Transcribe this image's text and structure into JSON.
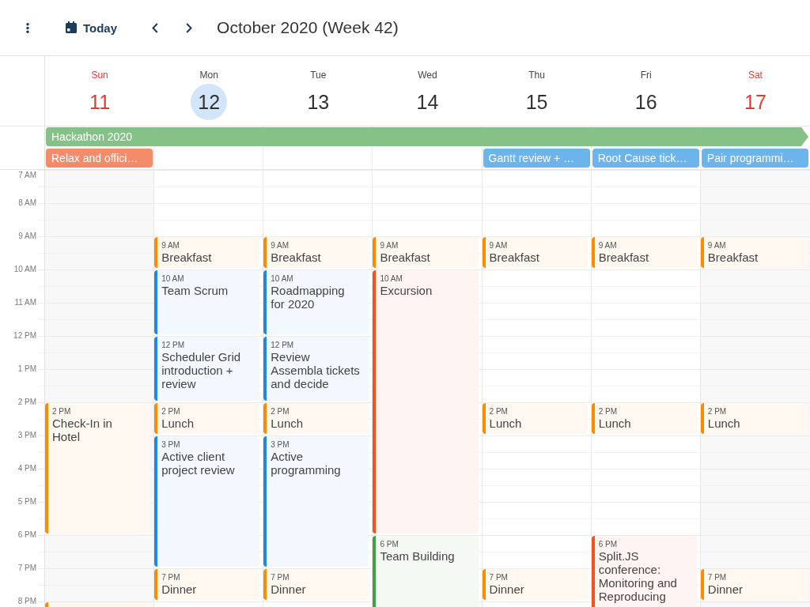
{
  "toolbar": {
    "today_button": "Today",
    "title": "October 2020 (Week 42)"
  },
  "days": [
    {
      "name": "Sun",
      "number": "11",
      "weekend": true,
      "today": false,
      "slots": [
        {
          "kind": "free"
        },
        {
          "kind": "free"
        },
        {
          "kind": "free"
        },
        {
          "kind": "free"
        },
        {
          "kind": "free"
        },
        {
          "kind": "free"
        },
        {
          "kind": "free"
        },
        {
          "kind": "event",
          "event": {
            "time": "2 PM",
            "title": "Check-In in Hotel",
            "color": "#fb8c00"
          }
        },
        {
          "kind": "continued"
        },
        {
          "kind": "continued"
        },
        {
          "kind": "continued"
        },
        {
          "kind": "free"
        },
        {
          "kind": "free"
        },
        {
          "kind": "event",
          "event": {
            "color": "#fb8c00"
          }
        }
      ]
    },
    {
      "name": "Mon",
      "number": "12",
      "weekend": false,
      "today": true,
      "slots": [
        {
          "kind": "free"
        },
        {
          "kind": "free"
        },
        {
          "kind": "event",
          "event": {
            "time": "9 AM",
            "title": "Breakfast",
            "color": "#fb8c00"
          }
        },
        {
          "kind": "event",
          "event": {
            "time": "10 AM",
            "title": "Team Scrum",
            "color": "#1e88e5"
          }
        },
        {
          "kind": "continued"
        },
        {
          "kind": "event",
          "event": {
            "time": "12 PM",
            "title": "Scheduler Grid introduction + review",
            "color": "#1e88e5"
          }
        },
        {
          "kind": "continued"
        },
        {
          "kind": "event",
          "event": {
            "time": "2 PM",
            "title": "Lunch",
            "color": "#fb8c00"
          }
        },
        {
          "kind": "event",
          "event": {
            "time": "3 PM",
            "title": "Active client project review",
            "color": "#1e88e5"
          }
        },
        {
          "kind": "continued"
        },
        {
          "kind": "continued"
        },
        {
          "kind": "continued"
        },
        {
          "kind": "event",
          "event": {
            "time": "7 PM",
            "title": "Dinner",
            "color": "#fb8c00"
          }
        },
        {
          "kind": "free"
        }
      ]
    },
    {
      "name": "Tue",
      "number": "13",
      "weekend": false,
      "today": false,
      "slots": [
        {
          "kind": "free"
        },
        {
          "kind": "free"
        },
        {
          "kind": "event",
          "event": {
            "time": "9 AM",
            "title": "Breakfast",
            "color": "#fb8c00"
          }
        },
        {
          "kind": "event",
          "event": {
            "time": "10 AM",
            "title": "Roadmapping for 2020",
            "color": "#1e88e5"
          }
        },
        {
          "kind": "continued"
        },
        {
          "kind": "event",
          "event": {
            "time": "12 PM",
            "title": "Review Assembla tickets and decide",
            "color": "#1e88e5"
          }
        },
        {
          "kind": "continued"
        },
        {
          "kind": "event",
          "event": {
            "time": "2 PM",
            "title": "Lunch",
            "color": "#fb8c00"
          }
        },
        {
          "kind": "event",
          "event": {
            "time": "3 PM",
            "title": "Active programming",
            "color": "#1e88e5"
          }
        },
        {
          "kind": "continued"
        },
        {
          "kind": "continued"
        },
        {
          "kind": "continued"
        },
        {
          "kind": "event",
          "event": {
            "time": "7 PM",
            "title": "Dinner",
            "color": "#fb8c00"
          }
        },
        {
          "kind": "free"
        }
      ]
    },
    {
      "name": "Wed",
      "number": "14",
      "weekend": false,
      "today": false,
      "slots": [
        {
          "kind": "free"
        },
        {
          "kind": "free"
        },
        {
          "kind": "event",
          "event": {
            "time": "9 AM",
            "title": "Breakfast",
            "color": "#fb8c00"
          }
        },
        {
          "kind": "event",
          "event": {
            "time": "10 AM",
            "title": "Excursion",
            "color": "#f4511e"
          }
        },
        {
          "kind": "continued"
        },
        {
          "kind": "continued"
        },
        {
          "kind": "continued"
        },
        {
          "kind": "continued"
        },
        {
          "kind": "continued"
        },
        {
          "kind": "continued"
        },
        {
          "kind": "continued"
        },
        {
          "kind": "event",
          "event": {
            "time": "6 PM",
            "title": "Team Building",
            "color": "#43a047"
          }
        },
        {
          "kind": "continued"
        },
        {
          "kind": "continued"
        }
      ]
    },
    {
      "name": "Thu",
      "number": "15",
      "weekend": false,
      "today": false,
      "slots": [
        {
          "kind": "free"
        },
        {
          "kind": "free"
        },
        {
          "kind": "event",
          "event": {
            "time": "9 AM",
            "title": "Breakfast",
            "color": "#fb8c00"
          }
        },
        {
          "kind": "free"
        },
        {
          "kind": "free"
        },
        {
          "kind": "free"
        },
        {
          "kind": "free"
        },
        {
          "kind": "event",
          "event": {
            "time": "2 PM",
            "title": "Lunch",
            "color": "#fb8c00"
          }
        },
        {
          "kind": "free"
        },
        {
          "kind": "free"
        },
        {
          "kind": "free"
        },
        {
          "kind": "free"
        },
        {
          "kind": "event",
          "event": {
            "time": "7 PM",
            "title": "Dinner",
            "color": "#fb8c00"
          }
        },
        {
          "kind": "free"
        }
      ]
    },
    {
      "name": "Fri",
      "number": "16",
      "weekend": false,
      "today": false,
      "slots": [
        {
          "kind": "free"
        },
        {
          "kind": "free"
        },
        {
          "kind": "event",
          "event": {
            "time": "9 AM",
            "title": "Breakfast",
            "color": "#fb8c00"
          }
        },
        {
          "kind": "free"
        },
        {
          "kind": "free"
        },
        {
          "kind": "free"
        },
        {
          "kind": "free"
        },
        {
          "kind": "event",
          "event": {
            "time": "2 PM",
            "title": "Lunch",
            "color": "#fb8c00"
          }
        },
        {
          "kind": "free"
        },
        {
          "kind": "free"
        },
        {
          "kind": "free"
        },
        {
          "kind": "event",
          "event": {
            "time": "6 PM",
            "title": "Split.JS conference: Monitoring and Reproducing",
            "color": "#f4511e"
          }
        },
        {
          "kind": "continued"
        },
        {
          "kind": "continued"
        }
      ]
    },
    {
      "name": "Sat",
      "number": "17",
      "weekend": true,
      "today": false,
      "slots": [
        {
          "kind": "free"
        },
        {
          "kind": "free"
        },
        {
          "kind": "event",
          "event": {
            "time": "9 AM",
            "title": "Breakfast",
            "color": "#fb8c00"
          }
        },
        {
          "kind": "free"
        },
        {
          "kind": "free"
        },
        {
          "kind": "free"
        },
        {
          "kind": "free"
        },
        {
          "kind": "event",
          "event": {
            "time": "2 PM",
            "title": "Lunch",
            "color": "#fb8c00"
          }
        },
        {
          "kind": "free"
        },
        {
          "kind": "free"
        },
        {
          "kind": "free"
        },
        {
          "kind": "free"
        },
        {
          "kind": "event",
          "event": {
            "time": "7 PM",
            "title": "Dinner",
            "color": "#fb8c00"
          }
        },
        {
          "kind": "free"
        }
      ]
    }
  ],
  "all_day": [
    {
      "cells": [
        {
          "kind": "event",
          "event": {
            "title": "Hackathon 2020",
            "color": "#86c288",
            "continues": true
          }
        },
        {
          "kind": "continued"
        },
        {
          "kind": "continued"
        },
        {
          "kind": "continued"
        },
        {
          "kind": "continued"
        },
        {
          "kind": "continued"
        },
        {
          "kind": "continued"
        }
      ]
    },
    {
      "cells": [
        {
          "kind": "event",
          "event": {
            "title": "Relax and offici…",
            "color": "#f48b6b",
            "continues": false
          }
        },
        {
          "kind": "free"
        },
        {
          "kind": "free"
        },
        {
          "kind": "free"
        },
        {
          "kind": "event",
          "event": {
            "title": "Gantt review + …",
            "color": "#6db3ec",
            "continues": false
          }
        },
        {
          "kind": "event",
          "event": {
            "title": "Root Cause tick…",
            "color": "#6db3ec",
            "continues": false
          }
        },
        {
          "kind": "event",
          "event": {
            "title": "Pair programmi…",
            "color": "#6db3ec",
            "continues": false
          }
        }
      ]
    }
  ],
  "time_grid": {
    "hours": [
      "7 AM",
      "8 AM",
      "9 AM",
      "10 AM",
      "11 AM",
      "12 PM",
      "1 PM",
      "2 PM",
      "3 PM",
      "4 PM",
      "5 PM",
      "6 PM",
      "7 PM",
      "8 PM"
    ]
  }
}
